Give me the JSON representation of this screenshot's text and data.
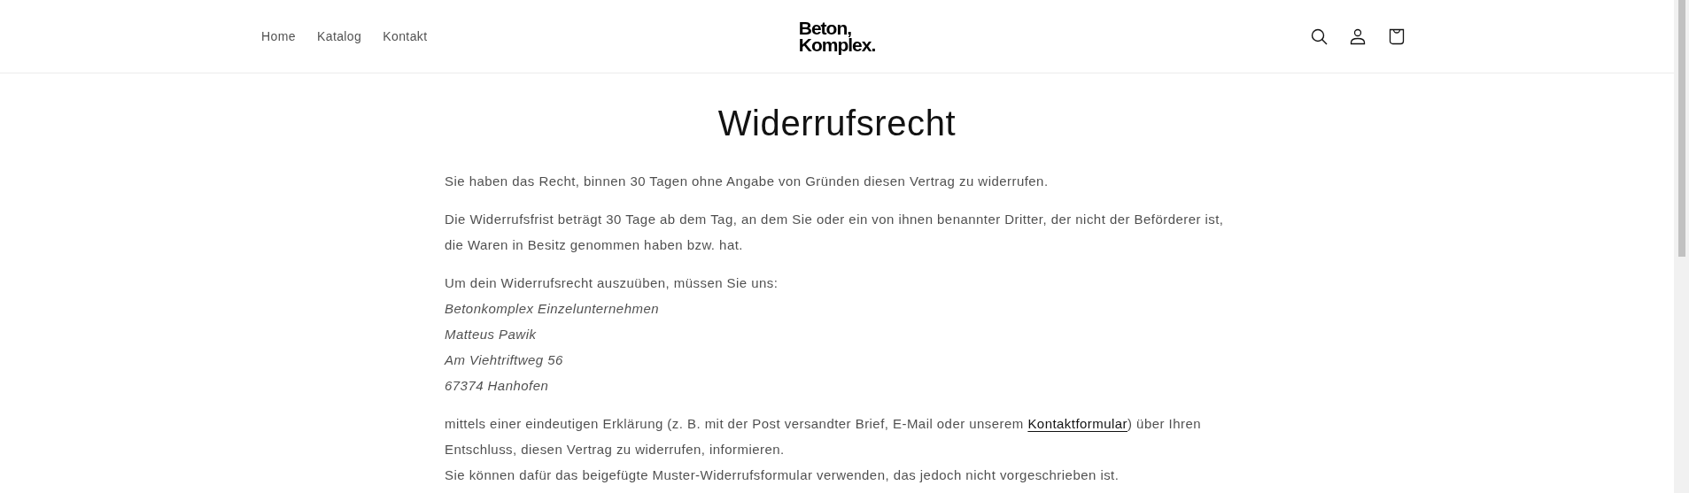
{
  "header": {
    "nav": [
      {
        "label": "Home"
      },
      {
        "label": "Katalog"
      },
      {
        "label": "Kontakt"
      }
    ],
    "logo": [
      "Beton,",
      "Komplex."
    ],
    "icons": [
      {
        "kind": "search"
      },
      {
        "kind": "account"
      },
      {
        "kind": "cart"
      }
    ]
  },
  "page": {
    "title": "Widerrufsrecht",
    "blocks": [
      {
        "kind": "paragraph",
        "text": "Sie haben das Recht, binnen 30 Tagen ohne Angabe von Gründen diesen Vertrag zu widerrufen."
      },
      {
        "kind": "paragraph",
        "text": "Die Widerrufsfrist beträgt 30 Tage ab dem Tag, an dem Sie oder ein von ihnen benannter Dritter, der nicht der Beförderer ist, die Waren in Besitz genommen haben bzw. hat."
      },
      {
        "kind": "lines",
        "lines": [
          {
            "text": "Um dein Widerrufsrecht auszuüben, müssen Sie uns:",
            "italic": false
          },
          {
            "text": "Betonkomplex Einzelunternehmen",
            "italic": true
          },
          {
            "text": "Matteus Pawik",
            "italic": true
          },
          {
            "text": "Am Viehtriftweg 56",
            "italic": true
          },
          {
            "text": "67374 Hanhofen",
            "italic": true
          }
        ]
      },
      {
        "kind": "linked",
        "before": "mittels einer eindeutigen Erklärung (z. B. mit der Post versandter Brief, E-Mail oder unserem ",
        "link": "Kontaktformular",
        "after": ") über Ihren Entschluss, diesen Vertrag zu widerrufen, informieren."
      },
      {
        "kind": "continuation",
        "text": "Sie können dafür das beigefügte Muster-Widerrufsformular verwenden, das jedoch nicht vorgeschrieben ist."
      }
    ]
  }
}
